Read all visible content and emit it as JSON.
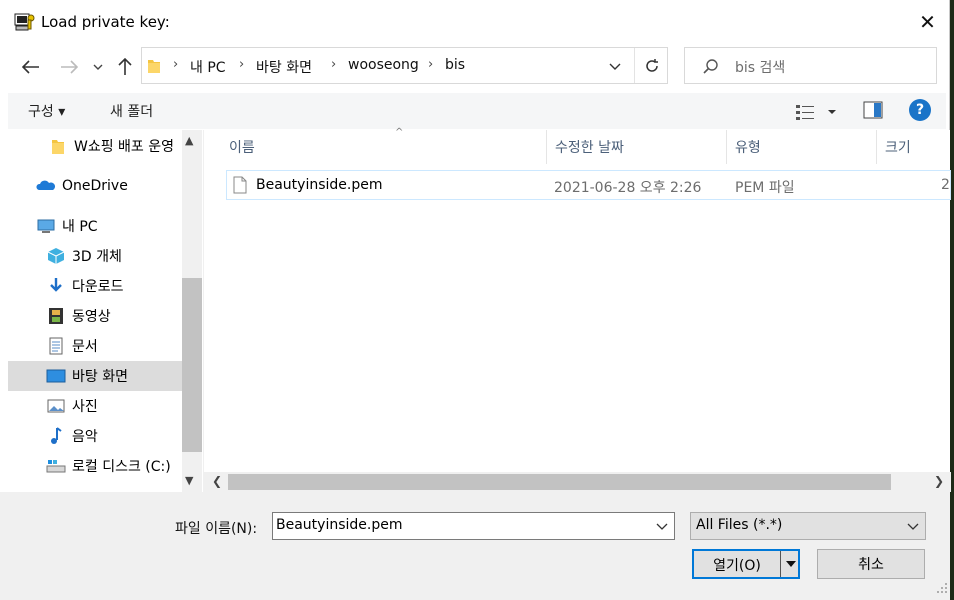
{
  "window": {
    "title": "Load private key:",
    "close_glyph": "✕"
  },
  "address_bar": {
    "breadcrumbs": [
      "내 PC",
      "바탕 화면",
      "wooseong",
      "bis"
    ],
    "separator": "›"
  },
  "search": {
    "placeholder": "bis 검색"
  },
  "toolbar": {
    "organize_label": "구성 ▾",
    "new_folder_label": "새 폴더",
    "help_label": "?"
  },
  "nav_pane": {
    "items": [
      {
        "label": "W쇼핑 배포 운영",
        "icon": "folder-icon"
      },
      {
        "label": "OneDrive",
        "icon": "cloud-icon"
      },
      {
        "label": "내 PC",
        "icon": "pc-icon"
      },
      {
        "label": "3D 개체",
        "icon": "cube-icon"
      },
      {
        "label": "다운로드",
        "icon": "download-icon"
      },
      {
        "label": "동영상",
        "icon": "film-icon"
      },
      {
        "label": "문서",
        "icon": "document-icon"
      },
      {
        "label": "바탕 화면",
        "icon": "desktop-icon",
        "selected": true
      },
      {
        "label": "사진",
        "icon": "picture-icon"
      },
      {
        "label": "음악",
        "icon": "music-icon"
      },
      {
        "label": "로컬 디스크 (C:)",
        "icon": "drive-icon"
      }
    ]
  },
  "file_list": {
    "columns": [
      "이름",
      "수정한 날짜",
      "유형",
      "크기"
    ],
    "rows": [
      {
        "name": "Beautyinside.pem",
        "modified": "2021-06-28 오후 2:26",
        "type": "PEM 파일",
        "size": "2"
      }
    ]
  },
  "footer": {
    "filename_label": "파일 이름(N):",
    "filename_value": "Beautyinside.pem",
    "filetype_value": "All Files (*.*)",
    "open_label": "열기(O)",
    "cancel_label": "취소"
  },
  "colors": {
    "accent": "#0078d7",
    "selection": "#cce8ff",
    "header_text": "#4c607a"
  }
}
